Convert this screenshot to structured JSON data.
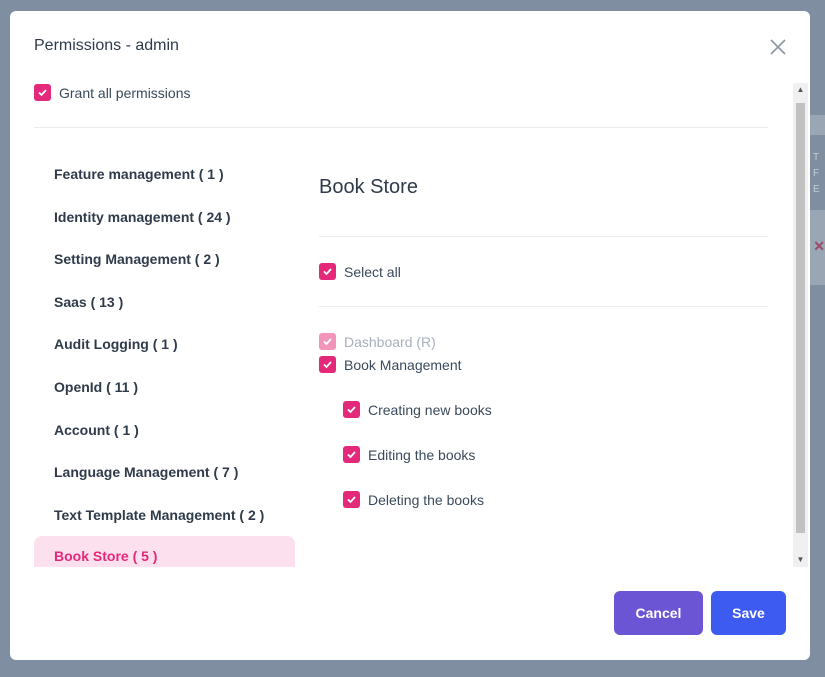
{
  "modal": {
    "title": "Permissions - admin",
    "grant_all_label": "Grant all permissions"
  },
  "sidebar": {
    "items": [
      {
        "label": "Feature management ( 1 )"
      },
      {
        "label": "Identity management ( 24 )"
      },
      {
        "label": "Setting Management ( 2 )"
      },
      {
        "label": "Saas ( 13 )"
      },
      {
        "label": "Audit Logging ( 1 )"
      },
      {
        "label": "OpenId ( 11 )"
      },
      {
        "label": "Account ( 1 )"
      },
      {
        "label": "Language Management ( 7 )"
      },
      {
        "label": "Text Template Management ( 2 )"
      },
      {
        "label": "Book Store ( 5 )",
        "active": true
      }
    ]
  },
  "panel": {
    "title": "Book Store",
    "select_all_label": "Select all",
    "permissions": [
      {
        "label": "Dashboard (R)",
        "checked": true,
        "disabled": true
      },
      {
        "label": "Book Management",
        "checked": true
      },
      {
        "label": "Creating new books",
        "checked": true
      },
      {
        "label": "Editing the books",
        "checked": true
      },
      {
        "label": "Deleting the books",
        "checked": true
      }
    ]
  },
  "footer": {
    "cancel_label": "Cancel",
    "save_label": "Save"
  },
  "background": {
    "text_fragments": [
      "T",
      "F",
      "E"
    ],
    "x_glyph": "✕"
  },
  "colors": {
    "accent": "#e5297a",
    "cancel": "#6b55d4",
    "save": "#3d5af1",
    "active_bg": "#fde0ee"
  }
}
